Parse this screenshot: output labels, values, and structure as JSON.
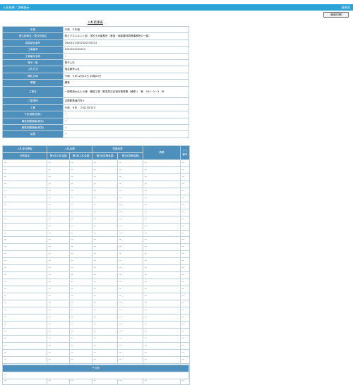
{
  "header": {
    "title": "入札結果／詳細表示",
    "right_label": "発表用"
  },
  "toolbar": {
    "print_label": "画面印刷"
  },
  "page_title": "入札結果表",
  "info_rows": [
    {
      "label": "年度",
      "value": "令和　５年度"
    },
    {
      "label": "発注部局名／発注所属名",
      "value": "県土マネジメント部　学校土木事務所（東部・南部農林振興事務所の一部）"
    },
    {
      "label": "調達案件番号",
      "value": "29001013052520230203"
    },
    {
      "label": "工事番号",
      "value": "1305250050212"
    },
    {
      "label": "工事番号名称",
      "value": "－"
    },
    {
      "label": "電子／紙",
      "value": "電子入札"
    },
    {
      "label": "入札方式",
      "value": "指名競争入札"
    },
    {
      "label": "開札日時",
      "value": "令和　５年12月14日 10時00分"
    },
    {
      "label": "業種",
      "value": "舗装"
    },
    {
      "label": "工事名",
      "value": "一般県道大久小川線　舗装工事（緊急防災区域対策事業（補修））　第　541－2－3　号"
    },
    {
      "label": "工事場所",
      "value": "吉野郡黒滝村村ヶ"
    },
    {
      "label": "工期",
      "value": "令和　６年　２月23日まで"
    },
    {
      "label": "予定価格(税抜)",
      "value": "－"
    },
    {
      "label": "最低制限価格(税抜)",
      "value": "－"
    },
    {
      "label": "最低制限価格(税抜)",
      "value": "－"
    },
    {
      "label": "結果",
      "value": "－"
    }
  ],
  "results": {
    "headers": {
      "bidder": "入札参加業者",
      "bidder_name": "代表者名",
      "bid_amount": "入札金額",
      "bid_first": "第1回入札金額",
      "bid_second": "第2回入札金額",
      "second_result": "再度結果",
      "second_first": "第1回見積金額",
      "second_second": "第2回見積金額",
      "remarks": "摘要",
      "re_bid_line1": "ｸﾞｼ",
      "re_bid_line2": "番号"
    },
    "rows": [
      [
        "－",
        "－",
        "－",
        "－",
        "－",
        "－",
        "－"
      ],
      [
        "－",
        "－",
        "－",
        "－",
        "－",
        "－",
        "－"
      ],
      [
        "－",
        "－",
        "－",
        "－",
        "－",
        "－",
        "－"
      ],
      [
        "－",
        "－",
        "－",
        "－",
        "－",
        "－",
        "－"
      ],
      [
        "－",
        "－",
        "－",
        "－",
        "－",
        "－",
        "－"
      ],
      [
        "－",
        "－",
        "－",
        "－",
        "－",
        "－",
        "－"
      ],
      [
        "－",
        "－",
        "－",
        "－",
        "－",
        "－",
        "－"
      ],
      [
        "－",
        "－",
        "－",
        "－",
        "－",
        "－",
        "－"
      ],
      [
        "－",
        "－",
        "－",
        "－",
        "－",
        "－",
        "－"
      ],
      [
        "－",
        "－",
        "－",
        "－",
        "－",
        "－",
        "－"
      ],
      [
        "－",
        "－",
        "－",
        "－",
        "－",
        "－",
        "－"
      ],
      [
        "－",
        "－",
        "－",
        "－",
        "－",
        "－",
        "－"
      ],
      [
        "－",
        "－",
        "－",
        "－",
        "－",
        "－",
        "－"
      ],
      [
        "－",
        "－",
        "－",
        "－",
        "－",
        "－",
        "－"
      ],
      [
        "－",
        "－",
        "－",
        "－",
        "－",
        "－",
        "－"
      ],
      [
        "－",
        "－",
        "－",
        "－",
        "－",
        "－",
        "－"
      ],
      [
        "－",
        "－",
        "－",
        "－",
        "－",
        "－",
        "－"
      ],
      [
        "－",
        "－",
        "－",
        "－",
        "－",
        "－",
        "－"
      ],
      [
        "－",
        "－",
        "－",
        "－",
        "－",
        "－",
        "－"
      ],
      [
        "－",
        "－",
        "－",
        "－",
        "－",
        "－",
        "－"
      ],
      [
        "－",
        "－",
        "－",
        "－",
        "－",
        "－",
        "－"
      ],
      [
        "－",
        "－",
        "－",
        "－",
        "－",
        "－",
        "－"
      ],
      [
        "－",
        "－",
        "－",
        "－",
        "－",
        "－",
        "－"
      ],
      [
        "－",
        "－",
        "－",
        "－",
        "－",
        "－",
        "－"
      ],
      [
        "－",
        "－",
        "－",
        "－",
        "－",
        "－",
        "－"
      ],
      [
        "－",
        "－",
        "－",
        "－",
        "－",
        "－",
        "－"
      ],
      [
        "－",
        "－",
        "－",
        "－",
        "－",
        "－",
        "－"
      ],
      [
        "－",
        "－",
        "－",
        "－",
        "－",
        "－",
        "－"
      ],
      [
        "－",
        "－",
        "－",
        "－",
        "－",
        "－",
        "－"
      ],
      [
        "－",
        "－",
        "－",
        "－",
        "－",
        "－",
        "－"
      ],
      [
        "－",
        "－",
        "－",
        "－",
        "－",
        "－",
        "－"
      ],
      [
        "－",
        "－",
        "－",
        "－",
        "－",
        "－",
        "－"
      ]
    ]
  },
  "other": {
    "title": "その他",
    "value": "－"
  },
  "colors": {
    "topbar": "#2aa3d6",
    "header_cell": "#4e8fbc",
    "border": "#b9cfdc"
  }
}
